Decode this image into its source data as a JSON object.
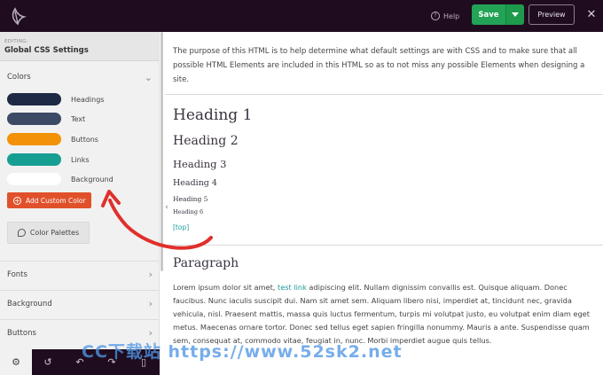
{
  "topbar": {
    "logo_icon": "sprout-logo-icon",
    "help_label": "Help",
    "save_label": "Save",
    "preview_label": "Preview"
  },
  "sidebar": {
    "editing_label": "EDITING:",
    "editing_title": "Global CSS Settings",
    "colors_label": "Colors",
    "colors": [
      {
        "label": "Headings",
        "color": "#1e2a45"
      },
      {
        "label": "Text",
        "color": "#3d4a66"
      },
      {
        "label": "Buttons",
        "color": "#f39208"
      },
      {
        "label": "Links",
        "color": "#179e93"
      },
      {
        "label": "Background",
        "color": "#ffffff"
      }
    ],
    "add_color_label": "Add Custom Color",
    "palettes_label": "Color Palettes",
    "sections": [
      {
        "label": "Fonts"
      },
      {
        "label": "Background"
      },
      {
        "label": "Buttons"
      }
    ]
  },
  "bottombar": {
    "items": [
      "gear-icon",
      "history-icon",
      "undo-icon",
      "redo-icon",
      "mobile-icon"
    ]
  },
  "content": {
    "intro": "The purpose of this HTML is to help determine what default settings are with CSS and to make sure that all possible HTML Elements are included in this HTML so as to not miss any possible Elements when designing a site.",
    "headings": [
      "Heading 1",
      "Heading 2",
      "Heading 3",
      "Heading 4",
      "Heading 5",
      "Heading 6"
    ],
    "top_link": "[top]",
    "paragraph_title": "Paragraph",
    "para_before_link": "Lorem ipsum dolor sit amet, ",
    "para_link": "test link",
    "para_after_link": " adipiscing elit. Nullam dignissim convallis est. Quisque aliquam. Donec faucibus. Nunc iaculis suscipit dui. Nam sit amet sem. Aliquam libero nisi, imperdiet at, tincidunt nec, gravida vehicula, nisl. Praesent mattis, massa quis luctus fermentum, turpis mi volutpat justo, eu volutpat enim diam eget metus. Maecenas ornare tortor. Donec sed tellus eget sapien fringilla nonummy. Mauris a ante. Suspendisse quam sem, consequat at, commodo vitae, feugiat in, nunc. Morbi imperdiet augue quis tellus."
  },
  "watermark": "CC下载站 https://www.52sk2.net",
  "accent_colors": {
    "topbar": "#1f0d1f",
    "save": "#22a356",
    "add_button": "#e0512b",
    "link": "#1f9a9a",
    "arrow": "#e0302b"
  }
}
